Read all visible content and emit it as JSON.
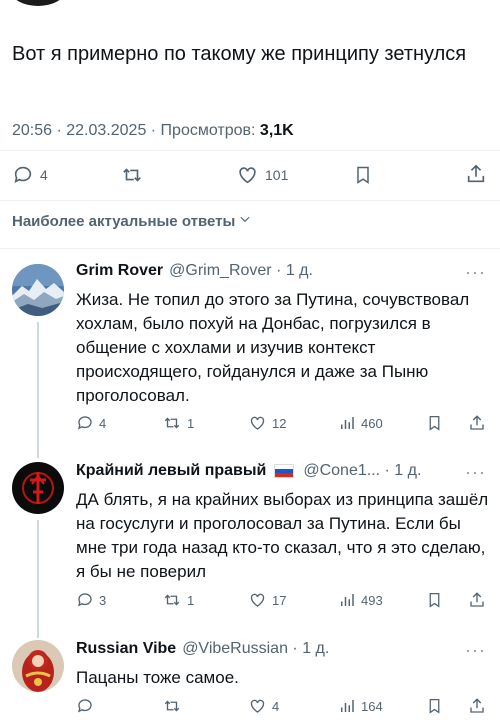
{
  "tweet": {
    "text": "Вот я примерно по такому же принципу зетнулся",
    "time": "20:56 · 22.03.2025 · Просмотров: ",
    "views": "3,1K",
    "replies": "4",
    "likes": "101"
  },
  "section": {
    "relevant_label": "Наиболее актуальные ответы"
  },
  "more_label": "···",
  "replies": [
    {
      "name": "Grim Rover",
      "handle": "@Grim_Rover · 1 д.",
      "text": "Жиза. Не топил до этого за Путина, сочувствовал хохлам, было похуй на Донбас, погрузился в общение с хохлами и изучив контекст происходящего, гойданулся и даже за Пыню проголосовал.",
      "replies": "4",
      "retweets": "1",
      "likes": "12",
      "views": "460"
    },
    {
      "name": "Крайний левый правый",
      "handle": "@Cone1... · 1 д.",
      "text": "ДА блять, я на крайних выборах из принципа зашёл на госуслуги и проголосовал за Путина. Если бы мне три года назад кто-то сказал, что я это сделаю, я бы не поверил",
      "replies": "3",
      "retweets": "1",
      "likes": "17",
      "views": "493"
    },
    {
      "name": "Russian Vibe",
      "handle": "@VibeRussian · 1 д.",
      "text": "Пацаны тоже самое.",
      "replies": "",
      "retweets": "",
      "likes": "4",
      "views": "164"
    }
  ],
  "colors": {
    "text": "#0f1419",
    "muted": "#536471",
    "divider": "#eff3f4",
    "thread": "#cfd9de"
  }
}
